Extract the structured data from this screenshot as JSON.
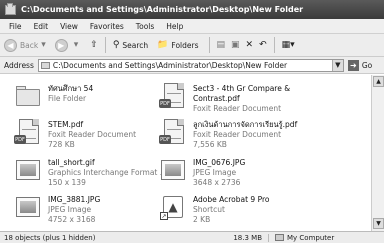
{
  "window": {
    "title": "C:\\Documents and Settings\\Administrator\\Desktop\\New Folder"
  },
  "menu": [
    "File",
    "Edit",
    "View",
    "Favorites",
    "Tools",
    "Help"
  ],
  "toolbar": {
    "back": "Back",
    "search": "Search",
    "folders": "Folders"
  },
  "address": {
    "label": "Address",
    "value": "C:\\Documents and Settings\\Administrator\\Desktop\\New Folder",
    "go": "Go"
  },
  "files": [
    {
      "name": "ทัศนศึกษา 54",
      "type": "File Folder",
      "detail": "",
      "icon": "folder-icon"
    },
    {
      "name": "Sect3 - 4th Gr Compare &",
      "type": "Contrast.pdf",
      "detail": "Foxit Reader Document",
      "icon": "pdf-icon"
    },
    {
      "name": "STEM.pdf",
      "type": "Foxit Reader Document",
      "detail": "728 KB",
      "icon": "pdf-icon"
    },
    {
      "name": "ลูกเงินด้านการจัดการเรียนรู้.pdf",
      "type": "Foxit Reader Document",
      "detail": "7,556 KB",
      "icon": "pdf-icon"
    },
    {
      "name": "tall_short.gif",
      "type": "Graphics Interchange Format ...",
      "detail": "150 x 139",
      "icon": "image-icon"
    },
    {
      "name": "IMG_0676.JPG",
      "type": "JPEG Image",
      "detail": "3648 x 2736",
      "icon": "image-icon"
    },
    {
      "name": "IMG_3881.JPG",
      "type": "JPEG Image",
      "detail": "4752 x 3168",
      "icon": "image-icon"
    },
    {
      "name": "Adobe Acrobat 9 Pro",
      "type": "Shortcut",
      "detail": "2 KB",
      "icon": "shortcut-icon"
    }
  ],
  "status": {
    "objects": "18 objects (plus 1 hidden)",
    "size": "18.3 MB",
    "location": "My Computer"
  }
}
